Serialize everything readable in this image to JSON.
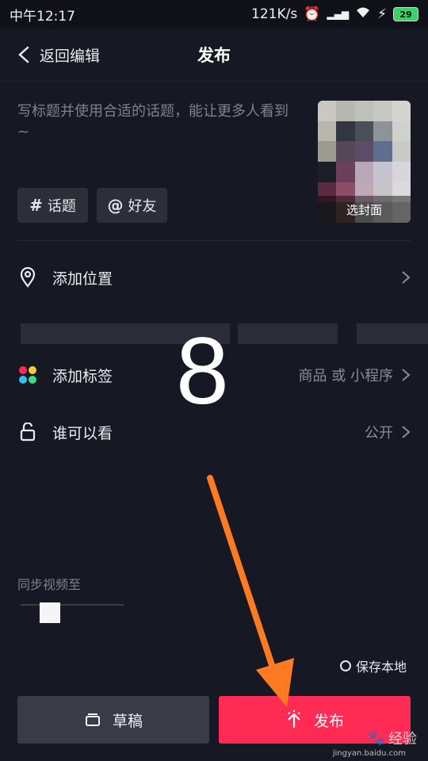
{
  "status_bar": {
    "time": "中午12:17",
    "network_speed": "121K/s",
    "battery": "29"
  },
  "header": {
    "back_label": "返回编辑",
    "title": "发布"
  },
  "caption": {
    "placeholder": "写标题并使用合适的话题，能让更多人看到~"
  },
  "cover": {
    "label": "选封面",
    "mosaic_colors": [
      "#c9c9c2",
      "#b7b8b2",
      "#bfc0bb",
      "#c7c8c3",
      "#d3d4cf",
      "#b9b7ad",
      "#323640",
      "#4a4f5a",
      "#8e939a",
      "#cfd2cc",
      "#9b9c8d",
      "#564758",
      "#5d4c66",
      "#5f6f8e",
      "#c9cac5",
      "#1b1f26",
      "#6c3f5b",
      "#b9a6b7",
      "#c8c3d0",
      "#d8d6da",
      "#5a2b3f",
      "#8a4f66",
      "#bfa8b6",
      "#c8c2c9",
      "#dad9db",
      "#2d2b32",
      "#59403f",
      "#8d8a8b",
      "#a6a6a8",
      "#b9b8ba"
    ]
  },
  "tags": {
    "topic_label": "话题",
    "friend_label": "好友"
  },
  "rows": {
    "location_label": "添加位置",
    "tag_label": "添加标签",
    "tag_value": "商品 或 小程序",
    "visibility_label": "谁可以看",
    "visibility_value": "公开"
  },
  "overlay_number": "8",
  "sync": {
    "title": "同步视频至"
  },
  "save_local": {
    "label": "保存本地"
  },
  "footer": {
    "draft_label": "草稿",
    "publish_label": "发布"
  },
  "watermark": {
    "brand": "经验",
    "site": "jingyan.baidu.com"
  },
  "colors": {
    "background": "#161823",
    "publish_button": "#fe2c55",
    "annotation_arrow": "#ff7a21",
    "tag_dots": [
      "#fe2c55",
      "#ffc83d",
      "#2fc3e7",
      "#3ddc84"
    ]
  }
}
